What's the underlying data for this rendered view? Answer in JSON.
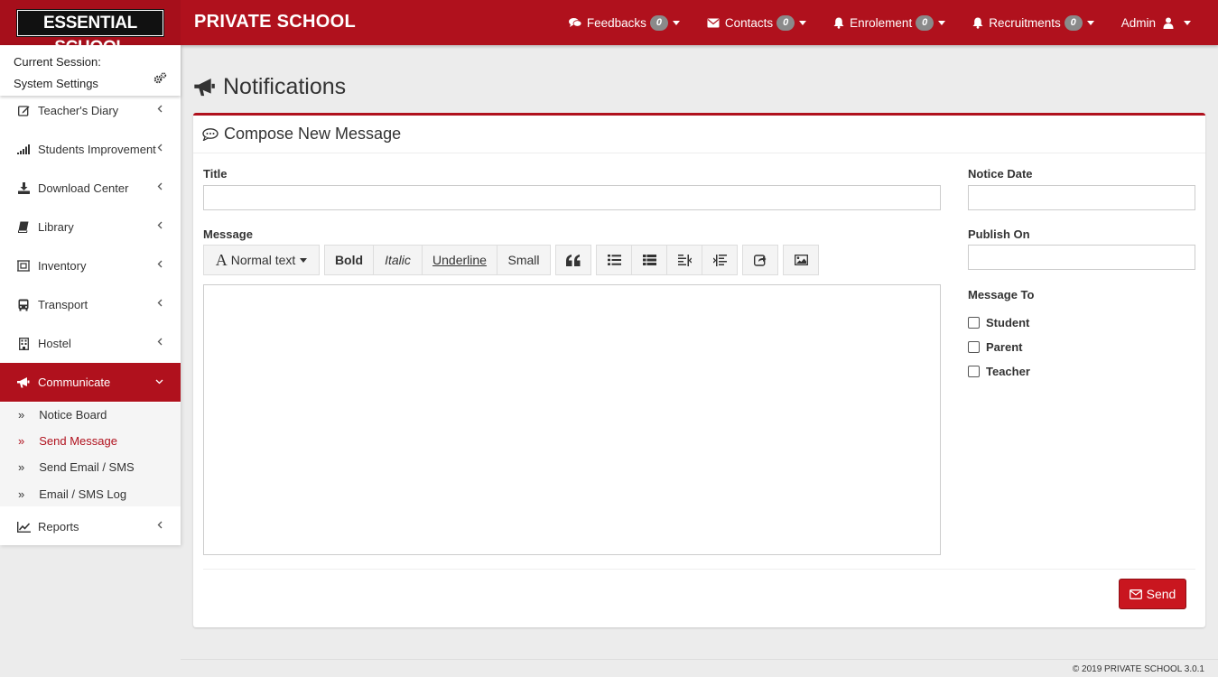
{
  "logo_text": "ESSENTIAL SCHOOL",
  "brand": "PRIVATE SCHOOL",
  "accent_color": "#b0111d",
  "nav": [
    {
      "label": "Feedbacks",
      "count": "0",
      "icon": "comments-icon"
    },
    {
      "label": "Contacts",
      "count": "0",
      "icon": "envelope-icon"
    },
    {
      "label": "Enrolement",
      "count": "0",
      "icon": "bell-icon"
    },
    {
      "label": "Recruitments",
      "count": "0",
      "icon": "bell-icon"
    },
    {
      "label": "Admin",
      "icon": "user-icon"
    }
  ],
  "session": {
    "line1": "Current Session:",
    "line2": "System Settings"
  },
  "sidebar": {
    "items": [
      {
        "label": "Teacher's Diary",
        "icon": "edit-icon"
      },
      {
        "label": "Students Improvement",
        "icon": "signal-icon"
      },
      {
        "label": "Download Center",
        "icon": "download-icon"
      },
      {
        "label": "Library",
        "icon": "book-icon"
      },
      {
        "label": "Inventory",
        "icon": "inventory-icon"
      },
      {
        "label": "Transport",
        "icon": "bus-icon"
      },
      {
        "label": "Hostel",
        "icon": "building-icon"
      },
      {
        "label": "Communicate",
        "icon": "bullhorn-icon",
        "active": true
      },
      {
        "label": "Reports",
        "icon": "chart-icon"
      }
    ],
    "submenu": [
      {
        "label": "Notice Board"
      },
      {
        "label": "Send Message",
        "current": true
      },
      {
        "label": "Send Email / SMS"
      },
      {
        "label": "Email / SMS Log"
      }
    ]
  },
  "page": {
    "title": "Notifications",
    "panel_title": "Compose New Message",
    "title_label": "Title",
    "message_label": "Message",
    "notice_date_label": "Notice Date",
    "publish_on_label": "Publish On",
    "message_to_label": "Message To",
    "recipients": [
      "Student",
      "Parent",
      "Teacher"
    ],
    "send_label": "Send"
  },
  "toolbar": {
    "format_label": "Normal text",
    "bold": "Bold",
    "italic": "Italic",
    "underline": "Underline",
    "small": "Small"
  },
  "footer": "© 2019 PRIVATE SCHOOL 3.0.1"
}
